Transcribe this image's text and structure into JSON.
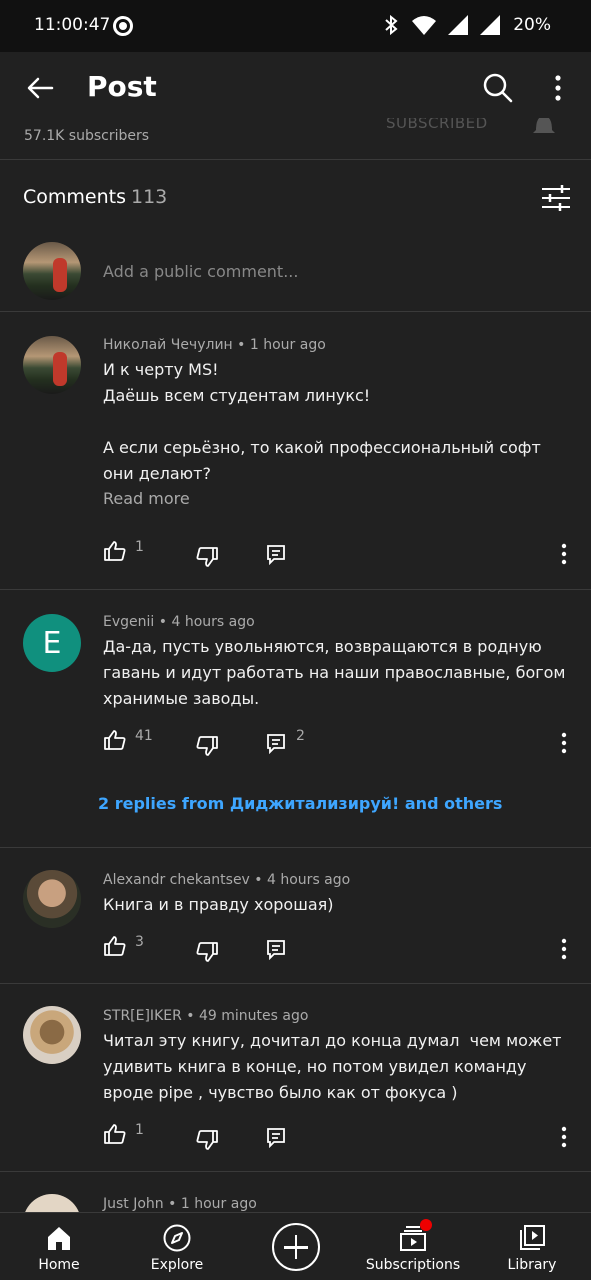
{
  "status_bar": {
    "time": "11:00:47",
    "battery": "20%"
  },
  "app_bar": {
    "title": "Post"
  },
  "channel": {
    "subscribers": "57.1K subscribers",
    "subscribed_label": "SUBSCRIBED"
  },
  "comments_header": {
    "label": "Comments",
    "count": "113"
  },
  "add_comment": {
    "placeholder": "Add a public comment..."
  },
  "comments": [
    {
      "author": "Николай Чечулин",
      "time": "1 hour ago",
      "text": "И к черту MS!\nДаёшь всем студентам линукс!\n\nА если серьёзно, то какой профессиональный софт они делают?",
      "read_more": "Read more",
      "likes": "1"
    },
    {
      "author": "Evgenii",
      "avatar_letter": "E",
      "time": "4 hours ago",
      "text": "Да-да, пусть увольняются, возвращаются в родную гавань и идут работать на наши православные, богом хранимые заводы.",
      "likes": "41",
      "replies_count": "2",
      "replies_link": "2 replies from Диджитализируй! and others"
    },
    {
      "author": "Alexandr chekantsev",
      "time": "4 hours ago",
      "text": "Книга и в правду хорошая)",
      "likes": "3"
    },
    {
      "author": "STR[E]IKER",
      "time": "49 minutes ago",
      "text": "Читал эту книгу, дочитал до конца думал  чем может удивить книга в конце, но потом увидел команду вроде pipe , чувство было как от фокуса )",
      "likes": "1"
    },
    {
      "author": "Just John",
      "time": "1 hour ago"
    }
  ],
  "separator": "•",
  "bottom_nav": {
    "home": "Home",
    "explore": "Explore",
    "subscriptions": "Subscriptions",
    "library": "Library"
  },
  "colors": {
    "background": "#212121",
    "link": "#3ea6ff",
    "accent_badge": "#ee0000"
  }
}
